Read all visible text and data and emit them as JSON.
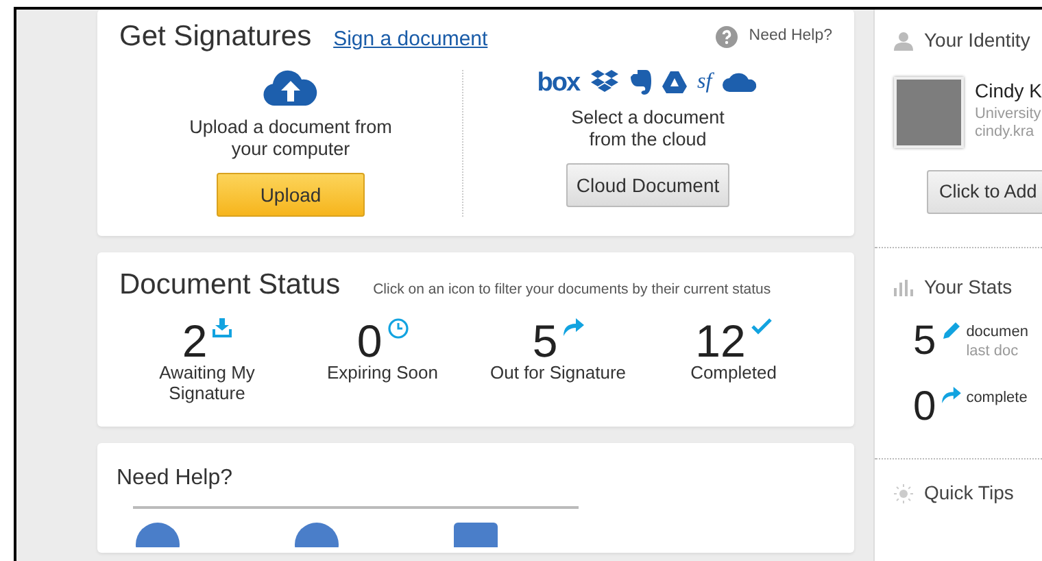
{
  "get_signatures": {
    "title": "Get Signatures",
    "link": "Sign a document",
    "help": "Need Help?",
    "upload": {
      "text": "Upload a document from your computer",
      "button": "Upload"
    },
    "cloud": {
      "text": "Select a document from the cloud",
      "button": "Cloud Document",
      "services": [
        "box",
        "sf"
      ]
    }
  },
  "document_status": {
    "title": "Document Status",
    "hint": "Click on an icon to filter your documents by their current status",
    "items": [
      {
        "count": "2",
        "label": "Awaiting My Signature",
        "kind": "awaiting"
      },
      {
        "count": "0",
        "label": "Expiring Soon",
        "kind": "expiring"
      },
      {
        "count": "5",
        "label": "Out for Signature",
        "kind": "out"
      },
      {
        "count": "12",
        "label": "Completed",
        "kind": "completed"
      }
    ]
  },
  "need_help": {
    "title": "Need Help?"
  },
  "sidebar": {
    "identity": {
      "title": "Your Identity",
      "name": "Cindy K",
      "org": "University",
      "email": "cindy.kra",
      "button": "Click to Add"
    },
    "stats": {
      "title": "Your Stats",
      "items": [
        {
          "count": "5",
          "kind": "edit",
          "text": "documen",
          "sub": "last doc"
        },
        {
          "count": "0",
          "kind": "share",
          "text": "complete"
        }
      ]
    },
    "tips": {
      "title": "Quick Tips"
    }
  }
}
